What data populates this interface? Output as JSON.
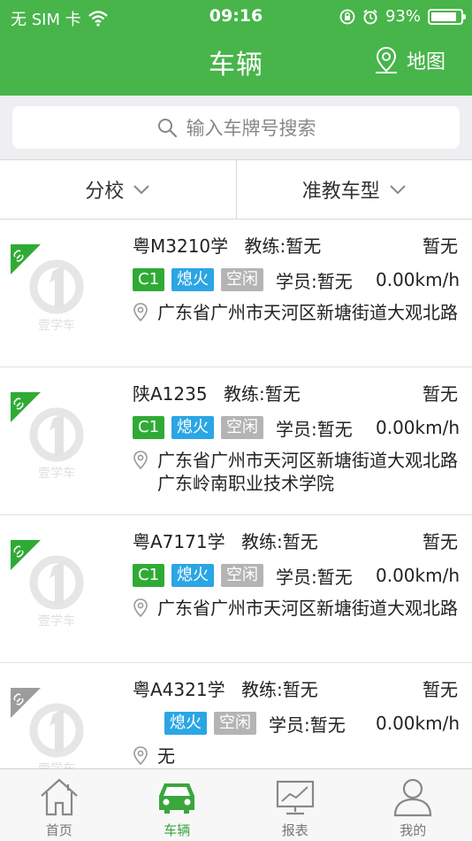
{
  "status_bar": {
    "carrier": "无 SIM 卡",
    "time": "09:16",
    "battery": "93%"
  },
  "header": {
    "title": "车辆",
    "map_label": "地图"
  },
  "search": {
    "placeholder": "输入车牌号搜索"
  },
  "filters": [
    {
      "label": "分校"
    },
    {
      "label": "准教车型"
    }
  ],
  "vehicles": [
    {
      "plate": "粤M3210学",
      "coach": "教练:暂无",
      "status": "暂无",
      "tags": [
        "C1",
        "熄火",
        "空闲"
      ],
      "student": "学员:暂无",
      "speed": "0.00km/h",
      "address": "广东省广州市天河区新塘街道大观北路",
      "online": true
    },
    {
      "plate": "陕A1235",
      "coach": "教练:暂无",
      "status": "暂无",
      "tags": [
        "C1",
        "熄火",
        "空闲"
      ],
      "student": "学员:暂无",
      "speed": "0.00km/h",
      "address": "广东省广州市天河区新塘街道大观北路广东岭南职业技术学院",
      "online": true
    },
    {
      "plate": "粤A7171学",
      "coach": "教练:暂无",
      "status": "暂无",
      "tags": [
        "C1",
        "熄火",
        "空闲"
      ],
      "student": "学员:暂无",
      "speed": "0.00km/h",
      "address": "广东省广州市天河区新塘街道大观北路",
      "online": true
    },
    {
      "plate": "粤A4321学",
      "coach": "教练:暂无",
      "status": "暂无",
      "tags": [
        "熄火",
        "空闲"
      ],
      "student": "学员:暂无",
      "speed": "0.00km/h",
      "address": "无",
      "online": false
    }
  ],
  "logo_text": "壹学车",
  "tabs": [
    {
      "label": "首页",
      "icon": "home-icon"
    },
    {
      "label": "车辆",
      "icon": "car-icon",
      "active": true
    },
    {
      "label": "报表",
      "icon": "chart-icon"
    },
    {
      "label": "我的",
      "icon": "user-icon"
    }
  ],
  "colors": {
    "brand": "#47b54a",
    "tag_green": "#2fab35",
    "tag_blue": "#2ba6e4",
    "tag_gray": "#b4b4b4"
  }
}
